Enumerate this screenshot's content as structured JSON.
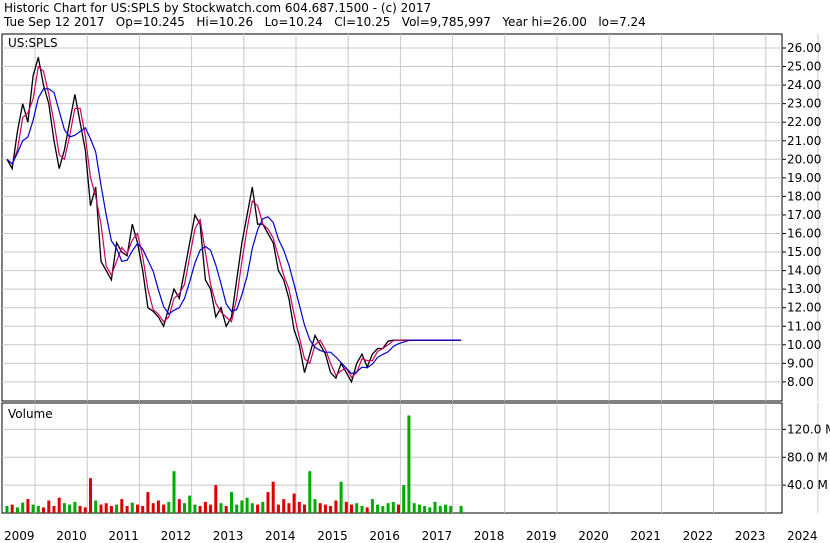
{
  "header": {
    "line1": "Historic Chart for US:SPLS by Stockwatch.com 604.687.1500 - (c) 2017",
    "line2": "Tue Sep 12 2017   Op=10.245   Hi=10.26   Lo=10.24   Cl=10.25   Vol=9,785,997   Year hi=26.00   lo=7.24"
  },
  "price_panel": {
    "symbol": "US:SPLS"
  },
  "volume_panel": {
    "label": "Volume"
  },
  "chart_data": [
    {
      "type": "line",
      "title": "US:SPLS",
      "x_ticks": [
        "2009",
        "2010",
        "2011",
        "2012",
        "2013",
        "2014",
        "2015",
        "2016",
        "2017",
        "2018",
        "2019",
        "2020",
        "2021",
        "2022",
        "2023",
        "2024"
      ],
      "y_ticks": [
        "26.00",
        "25.00",
        "24.00",
        "23.00",
        "22.00",
        "21.00",
        "20.00",
        "19.00",
        "18.00",
        "17.00",
        "16.00",
        "15.00",
        "14.00",
        "13.00",
        "12.00",
        "11.00",
        "10.00",
        "9.00",
        "8.00"
      ],
      "ylim": [
        7.24,
        26.0
      ],
      "grid": true,
      "colors": {
        "price": "#000000",
        "ma_short": "#cc0066",
        "ma_long": "#0000cc"
      },
      "series": [
        {
          "x": [
            2009.0,
            2009.1,
            2009.2,
            2009.3,
            2009.4,
            2009.5,
            2009.6,
            2009.7,
            2009.8,
            2009.9,
            2010.0,
            2010.1,
            2010.2,
            2010.3,
            2010.4,
            2010.5,
            2010.6,
            2010.7,
            2010.8,
            2010.9,
            2011.0,
            2011.1,
            2011.2,
            2011.3,
            2011.4,
            2011.5,
            2011.6,
            2011.7,
            2011.8,
            2011.9,
            2012.0,
            2012.1,
            2012.2,
            2012.3,
            2012.4,
            2012.5,
            2012.6,
            2012.7,
            2012.8,
            2012.9,
            2013.0,
            2013.1,
            2013.2,
            2013.3,
            2013.4,
            2013.5,
            2013.6,
            2013.7,
            2013.8,
            2013.9,
            2014.0,
            2014.1,
            2014.2,
            2014.3,
            2014.4,
            2014.5,
            2014.6,
            2014.7,
            2014.8,
            2014.9,
            2015.0,
            2015.1,
            2015.2,
            2015.3,
            2015.4,
            2015.5,
            2015.6,
            2015.7,
            2015.8,
            2015.9,
            2016.0,
            2016.1,
            2016.2,
            2016.3,
            2016.4,
            2016.5,
            2016.6,
            2016.7,
            2016.8,
            2016.9,
            2017.0,
            2017.1,
            2017.2,
            2017.3,
            2017.4,
            2017.5,
            2017.7
          ],
          "values": [
            20.0,
            19.5,
            21.5,
            23.0,
            22.0,
            24.5,
            25.5,
            24.0,
            23.0,
            21.0,
            19.5,
            20.5,
            22.0,
            23.5,
            22.0,
            20.5,
            17.5,
            18.5,
            14.5,
            14.0,
            13.5,
            15.5,
            15.0,
            14.8,
            16.5,
            15.5,
            14.0,
            12.0,
            11.8,
            11.5,
            11.0,
            12.0,
            13.0,
            12.5,
            14.0,
            15.5,
            17.0,
            16.5,
            13.5,
            13.0,
            11.5,
            12.0,
            11.0,
            11.5,
            13.5,
            15.5,
            17.0,
            18.5,
            16.5,
            16.5,
            16.0,
            15.5,
            14.0,
            13.5,
            12.5,
            10.8,
            10.0,
            8.5,
            9.5,
            10.5,
            10.0,
            9.5,
            8.5,
            8.2,
            9.0,
            8.5,
            8.0,
            9.0,
            9.5,
            8.8,
            9.5,
            9.8,
            9.8,
            10.2,
            10.25,
            10.24,
            10.25,
            10.25,
            10.25,
            10.25,
            10.25,
            10.25,
            10.25,
            10.25,
            10.25,
            10.25,
            10.25
          ]
        }
      ]
    },
    {
      "type": "bar",
      "title": "Volume",
      "y_ticks": [
        "120.0 M",
        "80.0 M",
        "40.0 M"
      ],
      "ylim": [
        0,
        145
      ],
      "colors": {
        "up": "#00aa00",
        "down": "#dd0000"
      },
      "series": [
        {
          "x": [
            2009.0,
            2009.1,
            2009.2,
            2009.3,
            2009.4,
            2009.5,
            2009.6,
            2009.7,
            2009.8,
            2009.9,
            2010.0,
            2010.1,
            2010.2,
            2010.3,
            2010.4,
            2010.5,
            2010.6,
            2010.7,
            2010.8,
            2010.9,
            2011.0,
            2011.1,
            2011.2,
            2011.3,
            2011.4,
            2011.5,
            2011.6,
            2011.7,
            2011.8,
            2011.9,
            2012.0,
            2012.1,
            2012.2,
            2012.3,
            2012.4,
            2012.5,
            2012.6,
            2012.7,
            2012.8,
            2012.9,
            2013.0,
            2013.1,
            2013.2,
            2013.3,
            2013.4,
            2013.5,
            2013.6,
            2013.7,
            2013.8,
            2013.9,
            2014.0,
            2014.1,
            2014.2,
            2014.3,
            2014.4,
            2014.5,
            2014.6,
            2014.7,
            2014.8,
            2014.9,
            2015.0,
            2015.1,
            2015.2,
            2015.3,
            2015.4,
            2015.5,
            2015.6,
            2015.7,
            2015.8,
            2015.9,
            2016.0,
            2016.1,
            2016.2,
            2016.3,
            2016.4,
            2016.5,
            2016.6,
            2016.7,
            2016.8,
            2016.9,
            2017.0,
            2017.1,
            2017.2,
            2017.3,
            2017.4,
            2017.5,
            2017.7
          ],
          "values": [
            10,
            12,
            8,
            15,
            20,
            12,
            10,
            8,
            18,
            10,
            22,
            14,
            12,
            16,
            10,
            8,
            50,
            18,
            12,
            14,
            10,
            12,
            20,
            10,
            15,
            12,
            10,
            30,
            14,
            18,
            12,
            16,
            60,
            20,
            14,
            25,
            12,
            10,
            16,
            12,
            40,
            14,
            10,
            30,
            12,
            18,
            22,
            14,
            12,
            16,
            30,
            45,
            12,
            20,
            14,
            28,
            16,
            12,
            60,
            20,
            14,
            12,
            10,
            18,
            45,
            16,
            12,
            14,
            10,
            8,
            20,
            12,
            10,
            14,
            16,
            12,
            40,
            140,
            14,
            12,
            10,
            8,
            16,
            10,
            12,
            10,
            10
          ]
        }
      ]
    }
  ]
}
